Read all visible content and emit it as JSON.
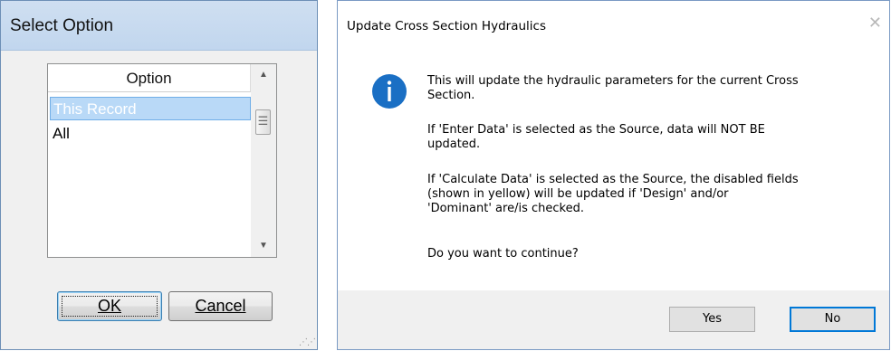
{
  "select_dialog": {
    "title": "Select Option",
    "list_header": "Option",
    "items": [
      {
        "label": "This Record",
        "selected": true
      },
      {
        "label": "All",
        "selected": false
      }
    ],
    "ok_label": "OK",
    "cancel_label": "Cancel"
  },
  "update_dialog": {
    "title": "Update Cross Section Hydraulics",
    "icon": "info-icon",
    "message": [
      "This will update the hydraulic parameters for the current Cross\nSection.",
      "If 'Enter Data' is selected as the Source, data will NOT BE\nupdated.",
      "If 'Calculate Data' is selected as the Source, the disabled fields\n(shown in yellow) will be updated if 'Design' and/or\n'Dominant' are/is checked.",
      "Do you want to continue?"
    ],
    "yes_label": "Yes",
    "no_label": "No"
  },
  "colors": {
    "selection": "#b9d9f7",
    "info_icon": "#1a6fc4",
    "default_button_border": "#0078d7"
  }
}
